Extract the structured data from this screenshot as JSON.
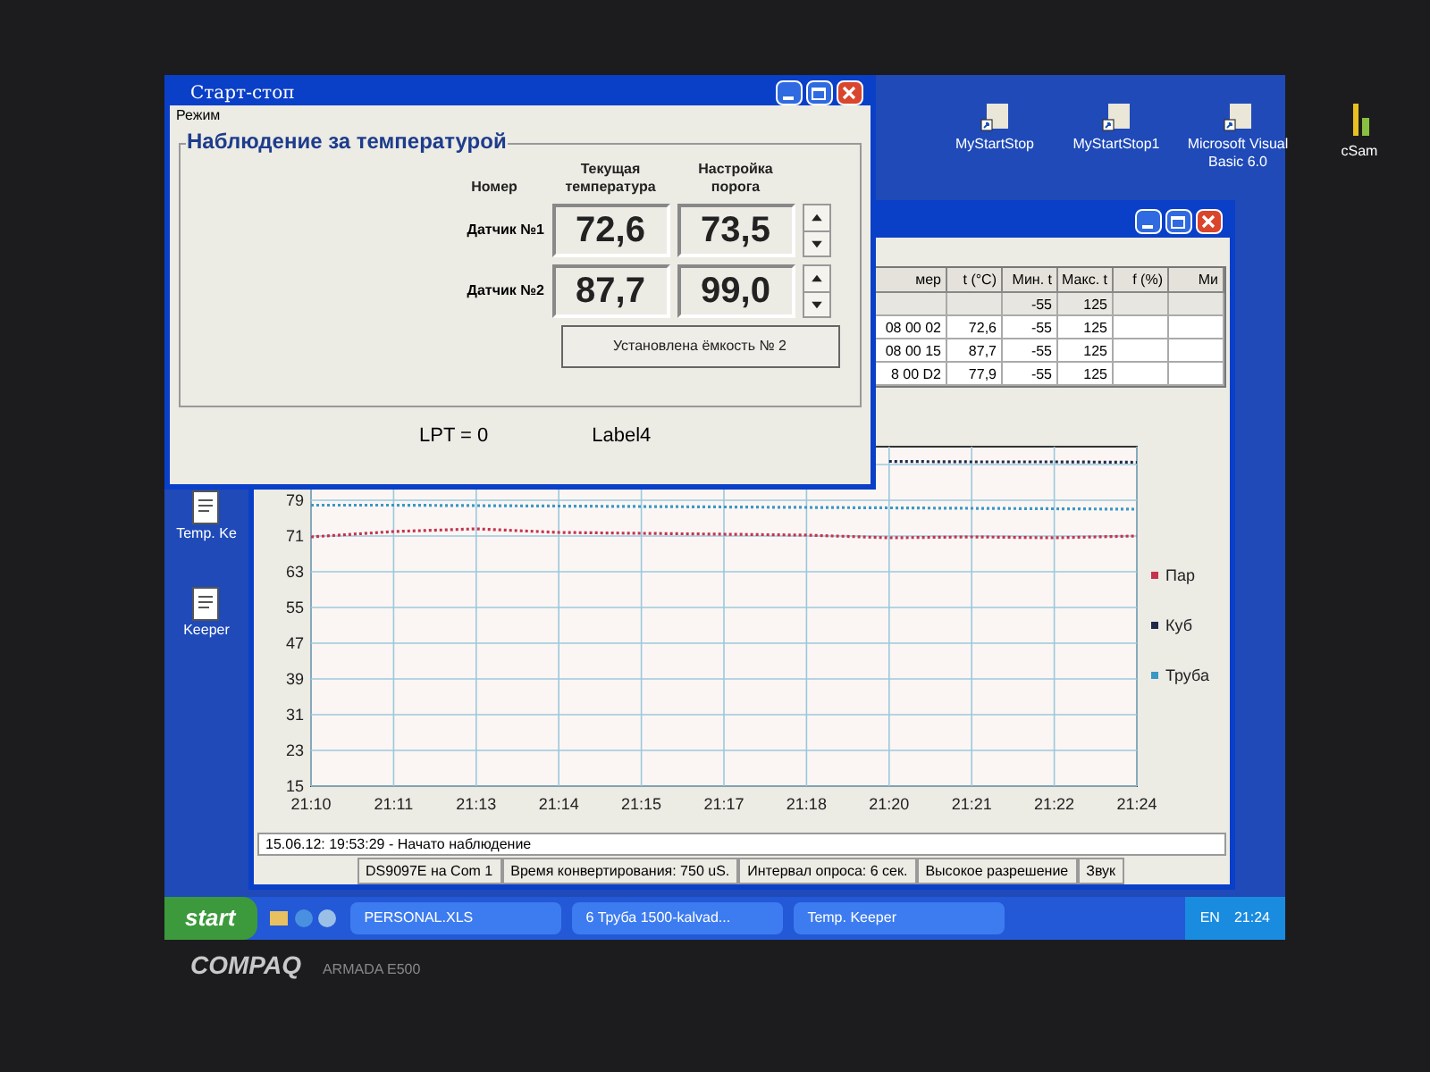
{
  "desktop_icons": [
    {
      "label": "MyStartStop"
    },
    {
      "label": "MyStartStop1"
    },
    {
      "label": "Microsoft Visual Basic 6.0"
    },
    {
      "label": "cSam"
    }
  ],
  "left_icons": [
    {
      "label": "Temp. Ke"
    },
    {
      "label": "Keeper"
    }
  ],
  "temp_keeper_window": {
    "table": {
      "columns": [
        "мер",
        "t (°C)",
        "Мин. t",
        "Макс. t",
        "f (%)",
        "Ми"
      ],
      "rows": [
        [
          null,
          null,
          "-55",
          "125",
          null,
          null
        ],
        [
          "08 00 02",
          "72,6",
          "-55",
          "125",
          null,
          null
        ],
        [
          "08 00 15",
          "87,7",
          "-55",
          "125",
          null,
          null
        ],
        [
          "8 00 D2",
          "77,9",
          "-55",
          "125",
          null,
          null
        ]
      ]
    },
    "chart_data": {
      "type": "line",
      "grid": true,
      "legend": true,
      "categories": [
        "21:10",
        "21:11",
        "21:13",
        "21:14",
        "21:15",
        "21:17",
        "21:18",
        "21:20",
        "21:21",
        "21:22",
        "21:24"
      ],
      "ylim": [
        15,
        91
      ],
      "yticks": [
        15,
        23,
        31,
        39,
        47,
        55,
        63,
        71,
        79
      ],
      "series": [
        {
          "name": "Пар",
          "color": "#c4344e",
          "line_style": "dotted",
          "values": [
            70.8,
            72.0,
            72.6,
            71.8,
            71.6,
            71.4,
            71.2,
            70.6,
            70.8,
            70.6,
            71.0
          ]
        },
        {
          "name": "Куб",
          "color": "#1f2a4a",
          "line_style": "dotted",
          "values": [
            null,
            null,
            null,
            null,
            null,
            null,
            null,
            87.7,
            87.6,
            87.6,
            87.5
          ]
        },
        {
          "name": "Труба",
          "color": "#3a98c4",
          "line_style": "dotted",
          "values": [
            77.9,
            77.9,
            77.8,
            77.7,
            77.6,
            77.5,
            77.4,
            77.3,
            77.2,
            77.1,
            77.0
          ]
        }
      ]
    },
    "log": "15.06.12: 19:53:29 - Начато наблюдение",
    "status_bar": [
      "DS9097E на Com 1",
      "Время конвертирования: 750 uS.",
      "Интервал опроса: 6 сек.",
      "Высокое разрешение",
      "Звук"
    ]
  },
  "start_stop_window": {
    "title": "Старт-стоп",
    "menu": [
      "Режим"
    ],
    "group_title": "Наблюдение за температурой",
    "columns": [
      "Номер",
      "Текущая температура",
      "Настройка порога"
    ],
    "sensors": [
      {
        "name": "Датчик №1",
        "current": "72,6",
        "threshold": "73,5"
      },
      {
        "name": "Датчик №2",
        "current": "87,7",
        "threshold": "99,0"
      }
    ],
    "button": "Установлена ёмкость № 2",
    "labels": [
      "LPT = 0",
      "Label4"
    ]
  },
  "taskbar": {
    "start": "start",
    "tasks": [
      "PERSONAL.XLS",
      "6 Труба 1500-kalvad...",
      "Temp. Keeper"
    ],
    "language": "EN",
    "clock": "21:24"
  },
  "bezel": {
    "brand": "COMPAQ",
    "model": "ARMADA E500"
  }
}
